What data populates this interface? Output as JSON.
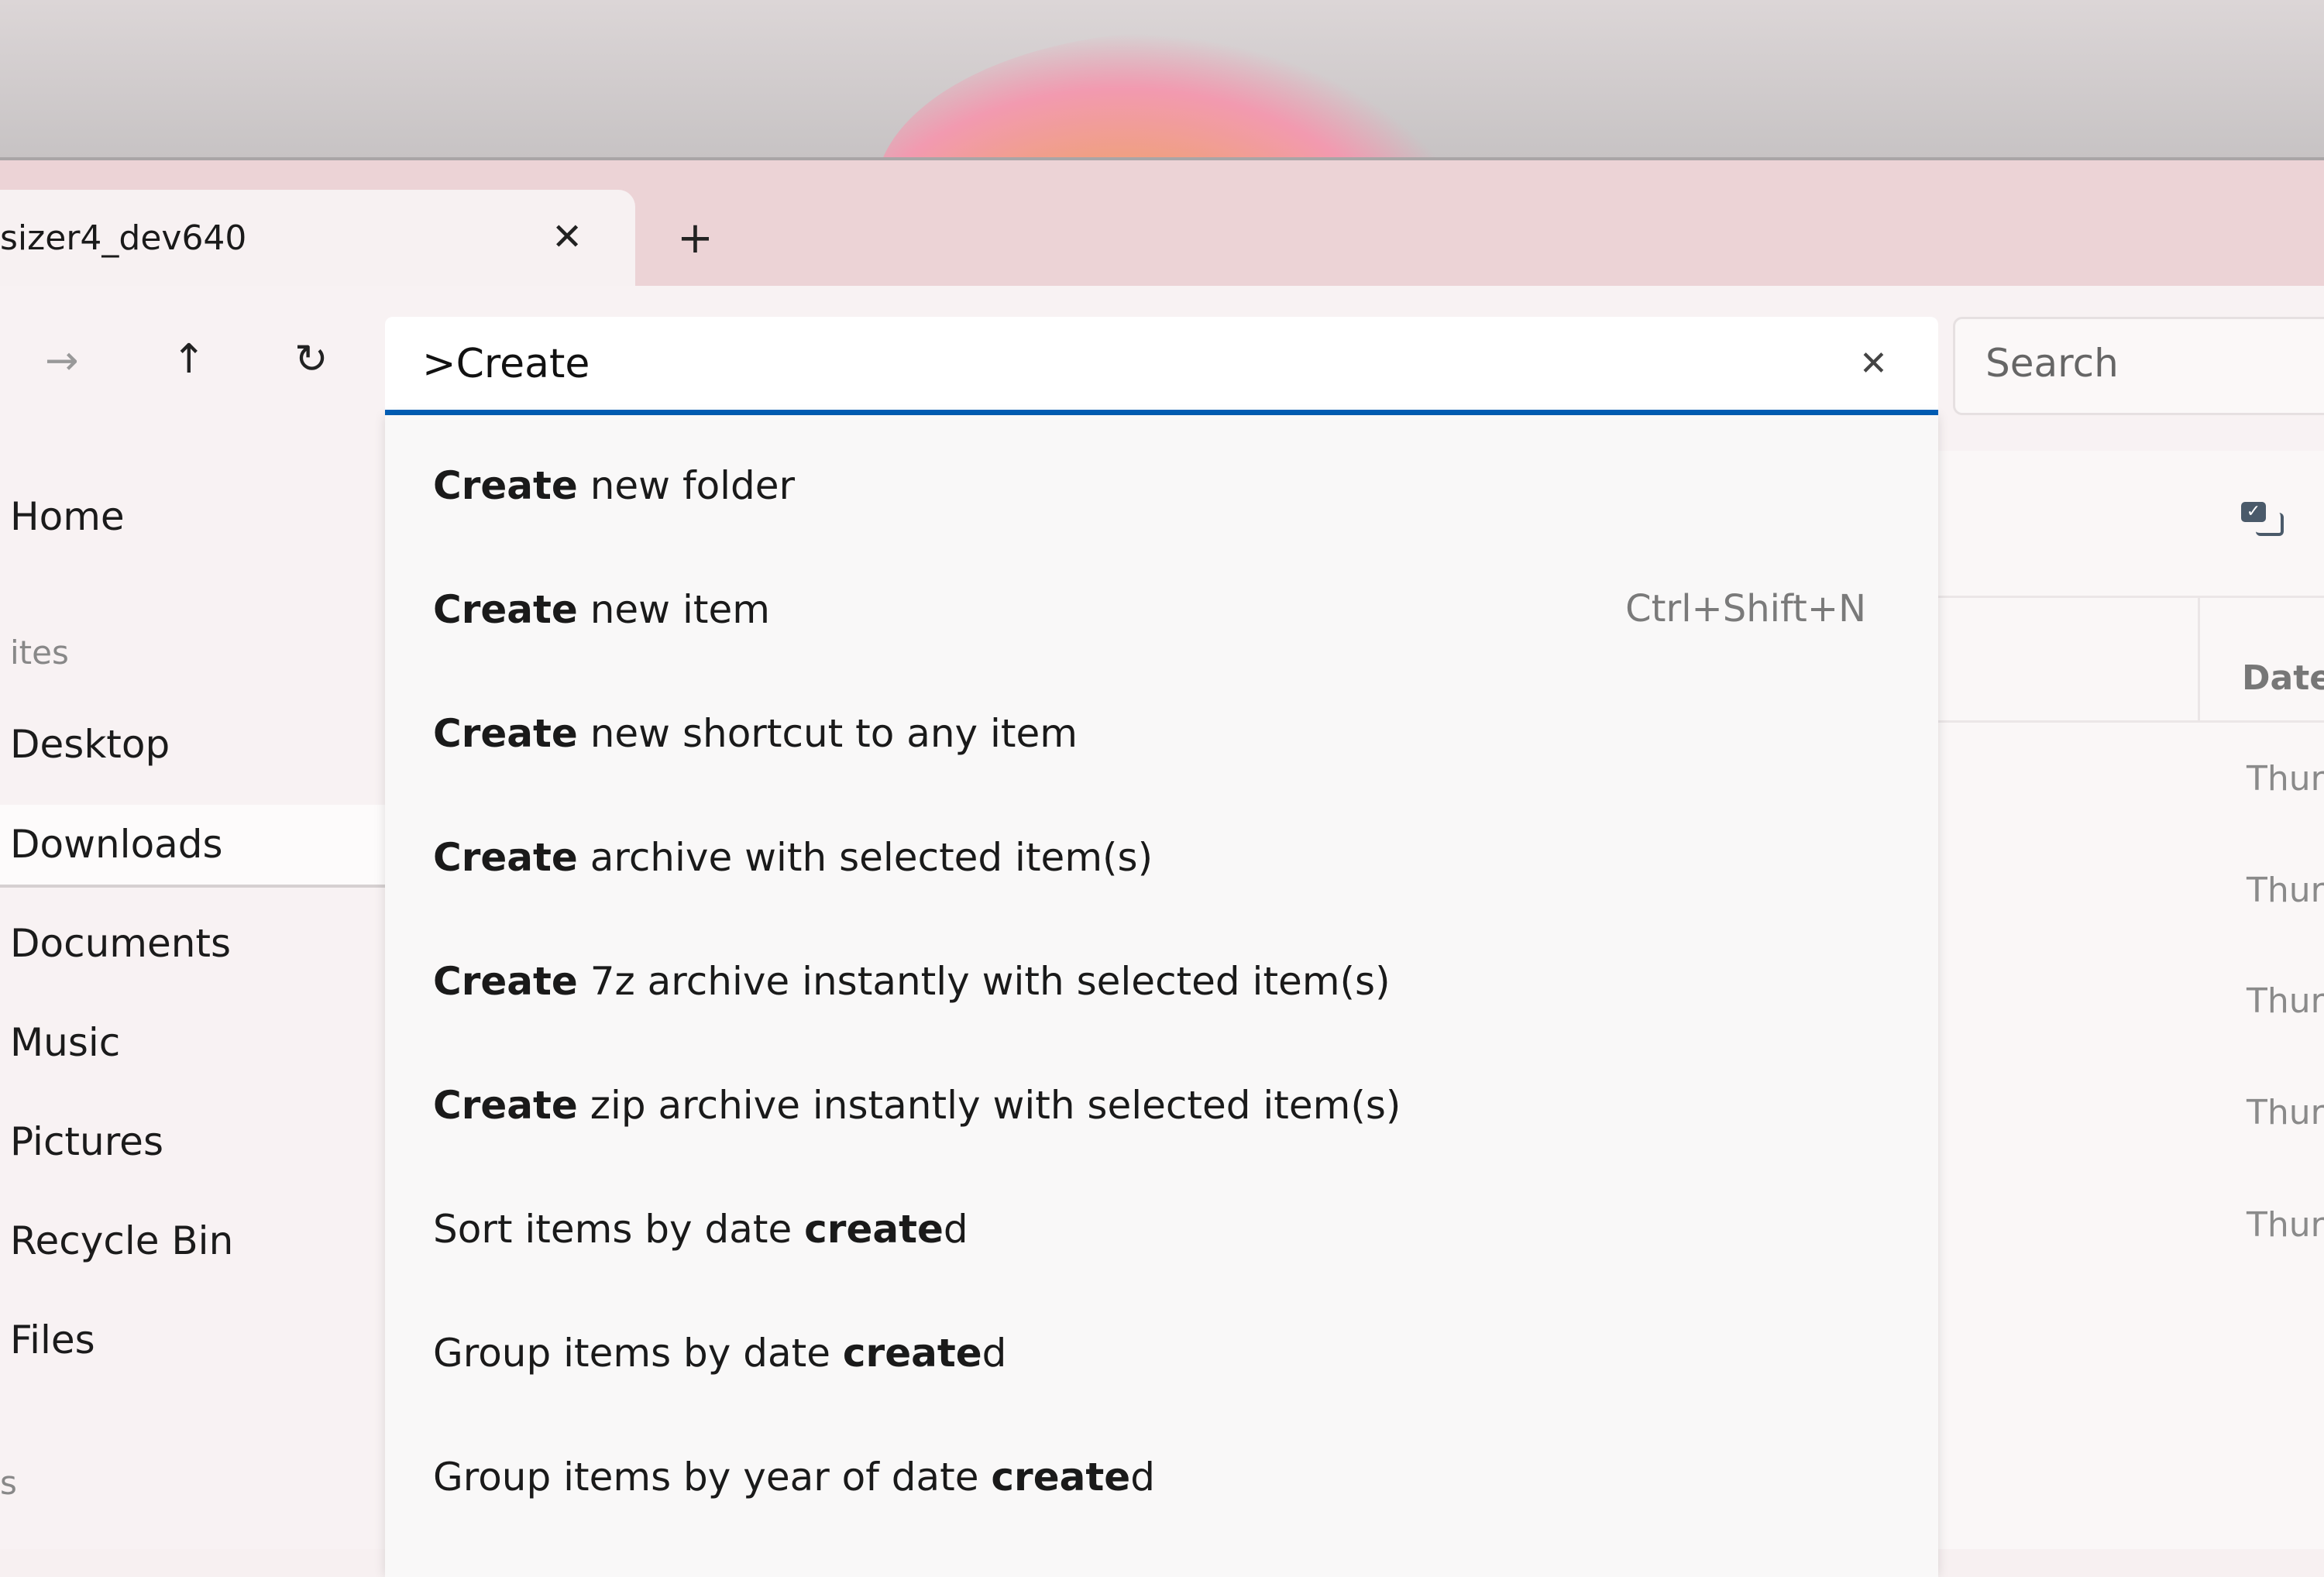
{
  "tab": {
    "title": "sizer4_dev640",
    "close_icon": "close-icon",
    "new_tab_icon": "plus-icon"
  },
  "toolbar": {
    "forward_icon": "arrow-right-icon",
    "up_icon": "arrow-up-icon",
    "refresh_icon": "refresh-icon"
  },
  "command_bar": {
    "value": ">Create",
    "clear_icon": "close-icon"
  },
  "search": {
    "placeholder": "Search"
  },
  "commands": [
    {
      "bold": "Create",
      "rest": " new folder",
      "shortcut": ""
    },
    {
      "bold": "Create",
      "rest": " new item",
      "shortcut": "Ctrl+Shift+N"
    },
    {
      "bold": "Create",
      "rest": " new shortcut to any item",
      "shortcut": ""
    },
    {
      "bold": "Create",
      "rest": " archive with selected item(s)",
      "shortcut": ""
    },
    {
      "bold": "Create",
      "rest": " 7z archive instantly with selected item(s)",
      "shortcut": ""
    },
    {
      "bold": "Create",
      "rest": " zip archive instantly with selected item(s)",
      "shortcut": ""
    },
    {
      "pre": "Sort items by date ",
      "bold": "create",
      "rest": "d"
    },
    {
      "pre": "Group items by date ",
      "bold": "create",
      "rest": "d"
    },
    {
      "pre": "Group items by year of date ",
      "bold": "create",
      "rest": "d"
    }
  ],
  "sidebar": {
    "home": "Home",
    "favorites_header": "ites",
    "items": [
      "Desktop",
      "Downloads",
      "Documents",
      "Music",
      "Pictures",
      "Recycle Bin",
      "Files"
    ],
    "selected": "Downloads",
    "section2_header": "s"
  },
  "file_list": {
    "column_header": "Date",
    "rows": [
      "Thur",
      "Thur",
      "Thur",
      "Thur",
      "Thur"
    ],
    "select_icon": "checkbox-select-icon"
  }
}
